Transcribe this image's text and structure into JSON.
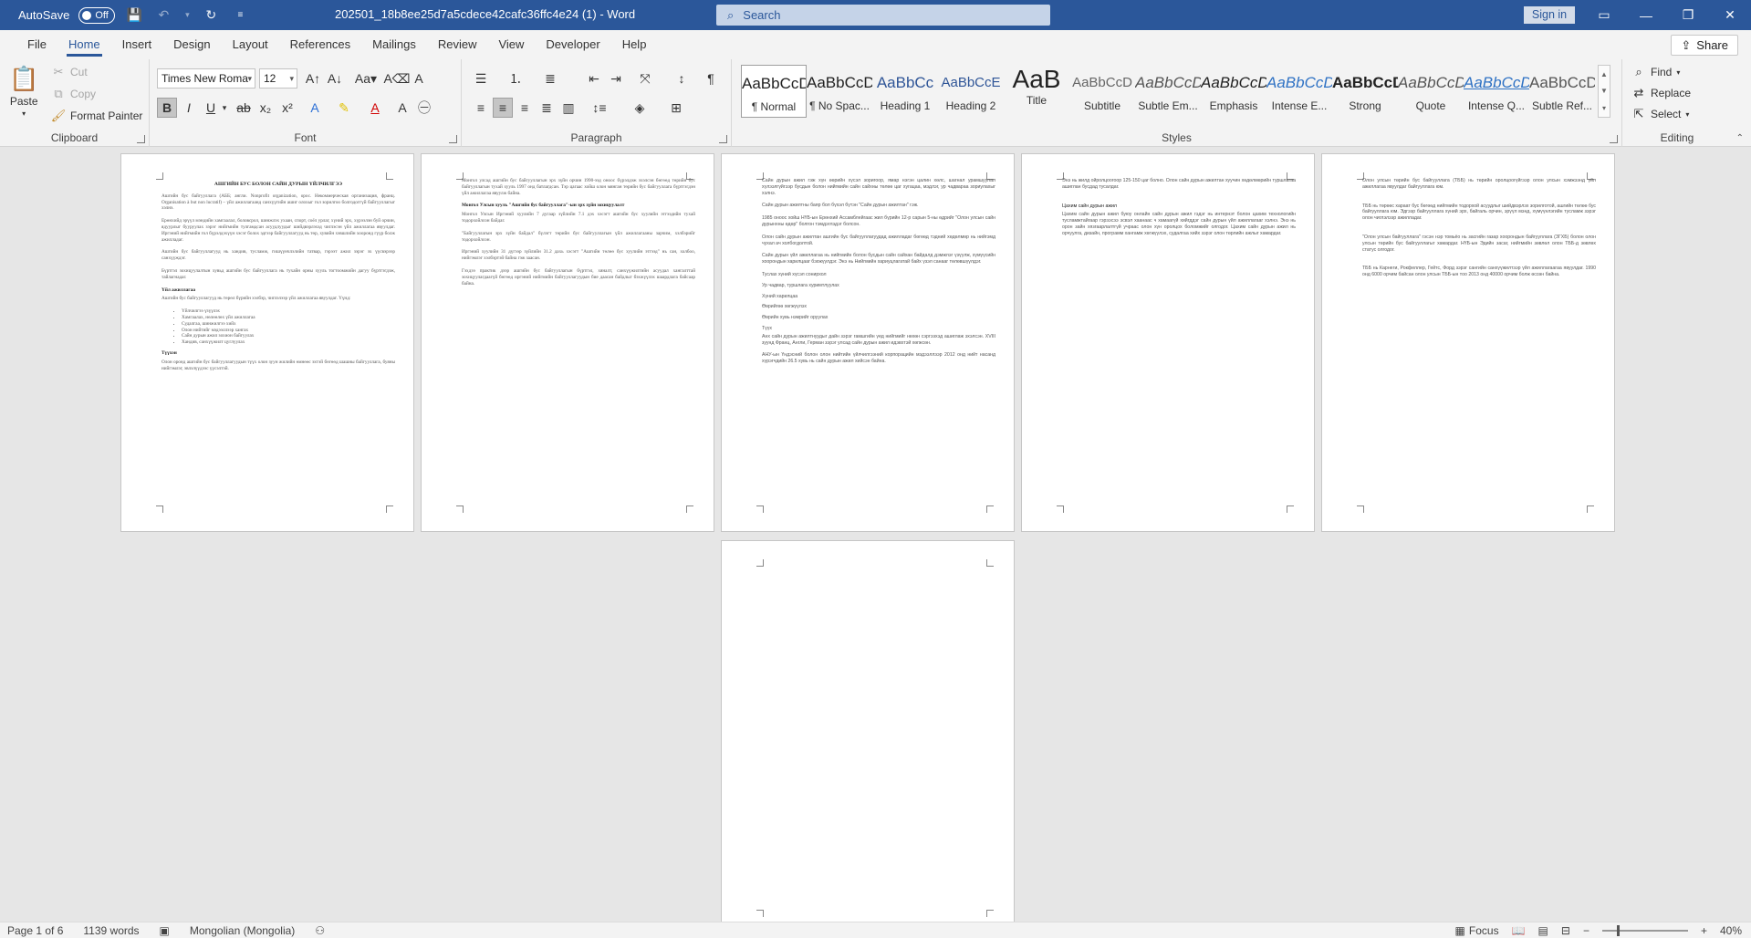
{
  "titlebar": {
    "autosave_label": "AutoSave",
    "autosave_state": "Off",
    "doc_title": "202501_18b8ee25d7a5cdece42cafc36ffc4e24 (1)  -  Word",
    "search_placeholder": "Search",
    "signin_label": "Sign in"
  },
  "menu": {
    "tabs": [
      "File",
      "Home",
      "Insert",
      "Design",
      "Layout",
      "References",
      "Mailings",
      "Review",
      "View",
      "Developer",
      "Help"
    ],
    "active": "Home",
    "share_label": "Share"
  },
  "ribbon": {
    "clipboard": {
      "label": "Clipboard",
      "paste": "Paste",
      "cut": "Cut",
      "copy": "Copy",
      "format_painter": "Format Painter"
    },
    "font": {
      "label": "Font",
      "family": "Times New Roma",
      "size": "12"
    },
    "paragraph": {
      "label": "Paragraph"
    },
    "styles": {
      "label": "Styles",
      "items": [
        {
          "sample": "AaBbCcDc",
          "name": "¶ Normal"
        },
        {
          "sample": "AaBbCcDc",
          "name": "¶ No Spac..."
        },
        {
          "sample": "AaBbCc",
          "name": "Heading 1"
        },
        {
          "sample": "AaBbCcE",
          "name": "Heading 2"
        },
        {
          "sample": "AaB",
          "name": "Title"
        },
        {
          "sample": "AaBbCcD",
          "name": "Subtitle"
        },
        {
          "sample": "AaBbCcDa",
          "name": "Subtle Em..."
        },
        {
          "sample": "AaBbCcDa",
          "name": "Emphasis"
        },
        {
          "sample": "AaBbCcDa",
          "name": "Intense E..."
        },
        {
          "sample": "AaBbCcDa",
          "name": "Strong"
        },
        {
          "sample": "AaBbCcDa",
          "name": "Quote"
        },
        {
          "sample": "AaBbCcDa",
          "name": "Intense Q..."
        },
        {
          "sample": "AaBbCcDa",
          "name": "Subtle Ref..."
        }
      ]
    },
    "editing": {
      "label": "Editing",
      "find": "Find",
      "replace": "Replace",
      "select": "Select"
    }
  },
  "pages": {
    "p1": {
      "title": "АШГИЙН БУС БОЛОН САЙН ДУРЫН ҮЙЛЧИЛГЭЭ",
      "para1": "Ашгийн бус байгууллага (АББ; англи. Nonprofit organization, орос. Некоммерческая организация, франц. Organisation à but non lucratif) – үйл ажиллагаанд санхүүгийн ашиг олохыг гол зорилгоо болгодоггүй байгууллагыг хэлнэ.",
      "para2": "Ерөнхийд эрүүл мэндийн хамгаалал, боловсрол, шинжлэх ухаан, спорт, соёл урлаг, хүний эрх, хүрээлэн буй орчин, ядуурлыг бууруулах зэрэг нийгмийн тулгамдсан асуудлуудыг шийдвэрлэхэд чиглэсэн үйл ажиллагаа явуулдаг. Иргэний нийгмийн гол бүрэлдэхүүн хэсэг болох эдгээр байгууллагууд нь төр, хувийн хэвшлийн хооронд гүүр болж ажилладаг.",
      "para3": "Ашгийн бус байгууллагууд нь хандив, тусламж, гишүүнчлэлийн татвар, гэрээт ажил зэрэг эх үүсвэрээр санхүүждэг.",
      "para4": "Бүртгэл зохицуулалтын хувьд ашгийн бус байгууллага нь тухайн орны хууль тогтоомжийн дагуу бүртгэгдэж, тайлагнадаг.",
      "head1": "Үйл ажиллагаа",
      "para5": "Ашгийн бус байгууллагууд нь төрөл бүрийн хэлбэр, чиглэлээр үйл ажиллагаа явуулдаг. Үүнд:",
      "bullets": [
        "Үйлчилгээ үзүүлэх",
        "Хамгаалах, нөлөөлөх үйл ажиллагаа",
        "Судалгаа, шинжилгээ хийх",
        "Олон нийтийг мэдээллээр хангах",
        "Сайн дурын ажил зохион байгуулах",
        "Хандив, санхүүжилт цуглуулах"
      ],
      "head2": "Түүхэн",
      "para6": "Олон оронд ашгийн бус байгууллагуудын түүх олон зуун жилийн өмнөөс эхтэй бөгөөд шашны байгууллага, буяны нийгэмлэг, эвлэлүүдээс үүсэлтэй."
    },
    "p2": {
      "para1": "Монгол улсад ашгийн бус байгууллагын эрх зүйн орчин 1990-ээд оноос бүрэлдэж эхэлсэн бөгөөд төрийн бус байгууллагын тухай хууль 1997 онд батлагдсан. Тэр цагаас хойш олон мянган төрийн бус байгууллага бүртгэгдэн үйл ажиллагаа явуулж байна.",
      "head1": "Монгол Улсын хууль \"Ашгийн бус байгууллага\"-ын эрх зүйн зохицуулалт",
      "para2": "Монгол Улсын Иргэний хуулийн 7 дугаар зүйлийн 7.1 дэх хэсэгт ашгийн бус хуулийн этгээдийн тухай тодорхойлсон байдаг.",
      "para3": "\"Байгууллагын эрх зүйн байдал\" бүлэгт төрийн бус байгууллагын үйл ажиллагааны зарчим, хэлбэрийг тодорхойлсон.",
      "para4": "Иргэний хуулийн 31 дүгээр зүйлийн 31.2 дахь хэсэгт \"Ашгийн төлөө бус хуулийн этгээд\" нь сан, холбоо, нийгэмлэг хэлбэртэй байна гэж заасан.",
      "para5": "Гэхдээ практик дээр ашгийн бус байгууллагын бүртгэл, хяналт, санхүүжилтийн асуудал хангалттай зохицуулагдаагүй бөгөөд иргэний нийгмийн байгууллагуудын бие даасан байдлыг бэхжүүлэх шаардлага байсаар байна."
    },
    "p3": {
      "para1": "Сайн дурын ажил гэж хүн өөрийн хүсэл зоригоор, ямар нэгэн цалин хөлс, шагнал урамшуулал хүлээлгүйгээр бусдын болон нийгмийн сайн сайхны төлөө цаг хугацаа, мэдлэг, ур чадвараа зориулахыг хэлнэ.",
      "para2": "Сайн дурын ажилтны баяр бол бүхэл бүтэн \"Сайн дурын ажилтан\" гэж.",
      "para3": "1985 оноос хойш НҮБ-ын Ерөнхий Ассамблейгаас жил бүрийн 12-р сарын 5-ны өдрийг \"Олон улсын сайн дурынхны өдөр\" болгон тэмдэглэдэг болсон.",
      "para4": "Олон сайн дурын ажилтан ашгийн бус байгууллагуудад ажилладаг бөгөөд тэдний хөдөлмөр нь нийгэмд чухал ач холбогдолтой.",
      "para5": "Сайн дурын үйл ажиллагаа нь нийгмийн болон бусдын сайн сайхан байдалд дэмжлэг үзүүлж, хүмүүсийн хоорондын харилцааг бэхжүүлдэг. Энэ нь Нийгмийн хариуцлагатай байх үзэл санааг төлөвшүүлдэг.",
      "list": [
        "Туслах хүний хүсэл сонирхол",
        "Ур чадвар, туршлага хуримтлуулах",
        "Хүний харилцаа",
        "Өөрийгөө хөгжүүлэх",
        "Өөрийн хувь нэмрийг оруулах",
        "Түүх"
      ],
      "para6": "Анх сайн дурын ажилтнуудыг дайн зэрэг гамшгийн үед нийгмийг нөхөн сэргээхэд ашиглаж эхэлсэн. XVIII зуунд Франц, Англи, Герман зэрэг улсад сайн дурын ажил идэвхтэй хөгжсөн.",
      "para7": "АНУ-ын Үндэсний болон олон нийтийн үйлчилгээний корпорацийн мэдээллээр 2012 онд нийт насанд хүрэгчдийн 26.5 хувь нь сайн дурын ажил хийсэн байна."
    },
    "p4": {
      "para1": "Энэ нь жилд ойролцоогоор 125-150 цаг болно. Олон сайн дурын ажилтан хуучин хөдөлмөрийн туршлагаа ашиглан бусдад тусалдаг.",
      "head1": "Цахим сайн дурын ажил",
      "para2": "Цахим сайн дурын ажил буюу онлайн сайн дурын ажил гэдэг нь интернэт болон цахим технологийн тусламжтайгаар гэрээсээ эсвэл хаанаас ч хамаагүй хийгддэг сайн дурын үйл ажиллагааг хэлнэ. Энэ нь орон зайн хязгаарлалтгүй учраас олон хүн оролцох боломжийг олгодог. Цахим сайн дурын ажил нь орчуулга, дизайн, программ хангамж хөгжүүлэх, судалгаа хийх зэрэг олон төрлийн ажлыг хамардаг."
    },
    "p5": {
      "para1": "Олон улсын төрийн бус байгууллага (ТББ) нь төрийн оролцоогүйгээр олон улсын хэмжээнд үйл ажиллагаа явуулдаг байгууллага юм.",
      "para2": "ТББ нь төрөөс хараат бус бөгөөд нийгмийн тодорхой асуудлыг шийдвэрлэх зорилготой, ашгийн төлөө бус байгууллага юм. Эдгээр байгууллага хүний эрх, байгаль орчин, эрүүл мэнд, хүмүүнлэгийн тусламж зэрэг олон чиглэлээр ажилладаг.",
      "para3": "\"Олон улсын байгууллага\" гэсэн нэр томьёо нь засгийн газар хоорондын байгууллага (ЗГХБ) болон олон улсын төрийн бус байгууллагыг хамардаг. НҮБ-ын Эдийн засаг, нийгмийн зөвлөл олон ТББ-д зөвлөх статус олгодог.",
      "para4": "ТББ нь Карнеги, Рокфеллер, Гейтс, Форд зэрэг сангийн санхүүжилтээр үйл ажиллагаагаа явуулдаг. 1990 онд 6000 орчим байсан олон улсын ТББ-ын тоо 2013 онд 40000 орчим болж өссөн байна."
    }
  },
  "statusbar": {
    "page": "Page 1 of 6",
    "words": "1139 words",
    "language": "Mongolian (Mongolia)",
    "focus": "Focus",
    "zoom": "40%",
    "zoom_level": 0.4
  }
}
